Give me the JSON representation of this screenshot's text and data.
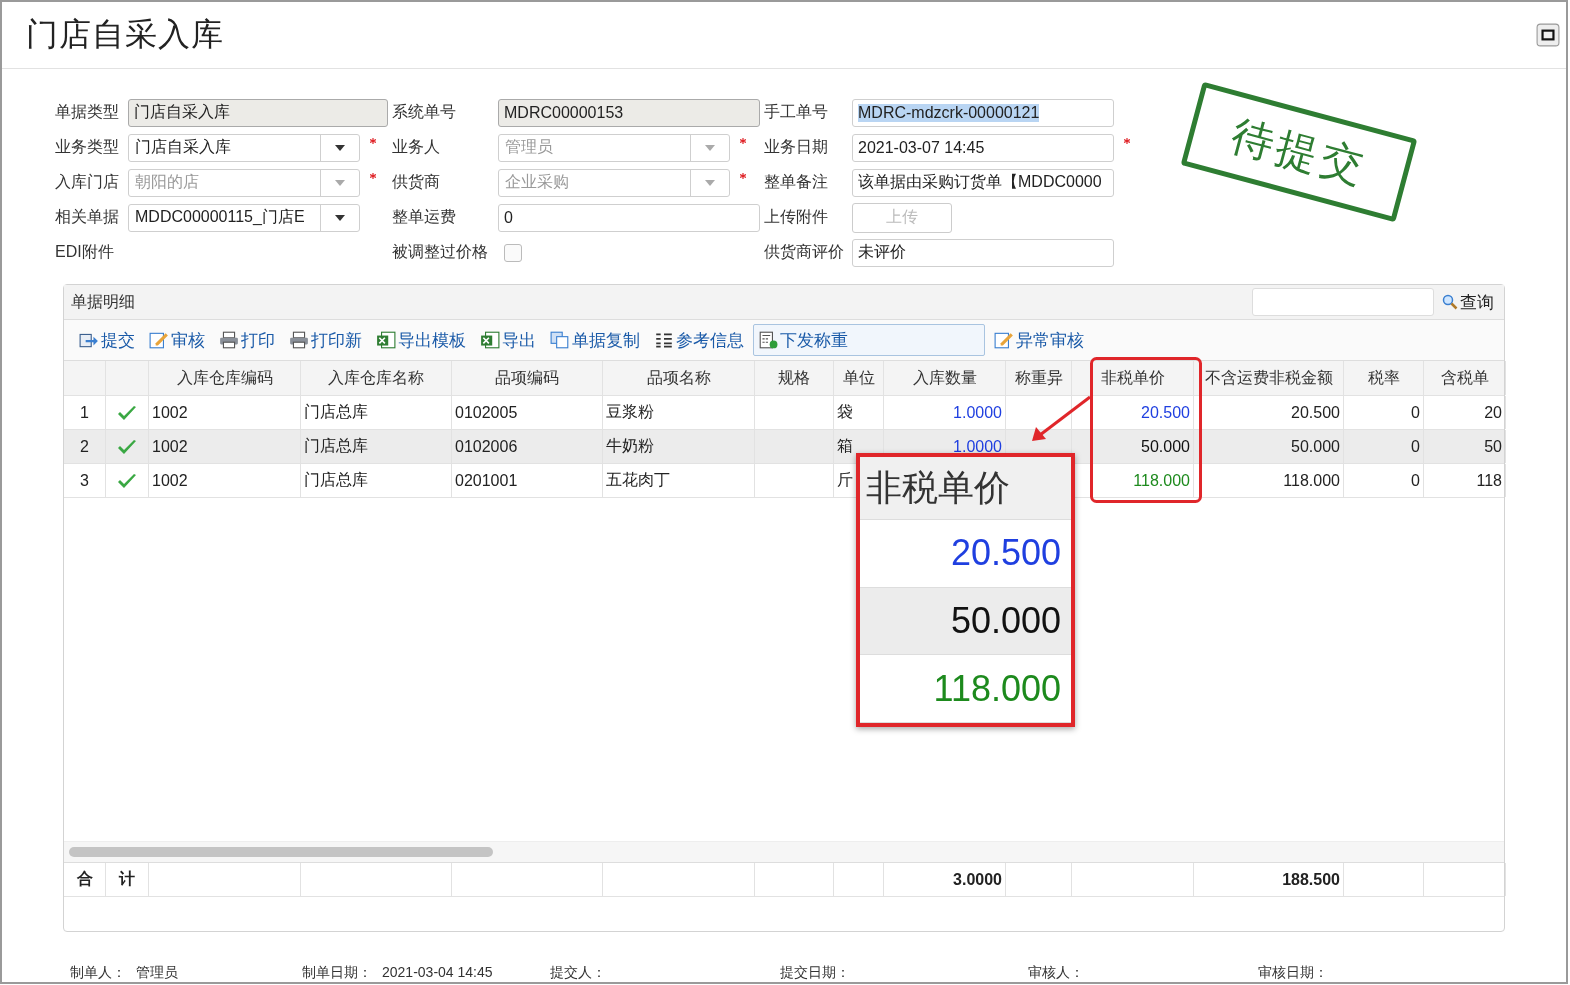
{
  "window": {
    "title": "门店自采入库"
  },
  "form": {
    "rows": [
      [
        {
          "label": "单据类型",
          "value": "门店自采入库",
          "kind": "readonly"
        },
        {
          "label": "系统单号",
          "value": "MDRC00000153",
          "kind": "readonly"
        },
        {
          "label": "手工单号",
          "value": "MDRC-mdzcrk-00000121",
          "kind": "text",
          "highlighted": true
        }
      ],
      [
        {
          "label": "业务类型",
          "value": "门店自采入库",
          "kind": "select",
          "required": true,
          "disabled": false
        },
        {
          "label": "业务人",
          "value": "管理员",
          "kind": "select",
          "required": true,
          "disabled": true
        },
        {
          "label": "业务日期",
          "value": "2021-03-07 14:45",
          "kind": "text",
          "required": true
        }
      ],
      [
        {
          "label": "入库门店",
          "value": "朝阳的店",
          "kind": "select",
          "required": true,
          "disabled": true
        },
        {
          "label": "供货商",
          "value": "企业采购",
          "kind": "select",
          "required": true,
          "disabled": true
        },
        {
          "label": "整单备注",
          "value": "该单据由采购订货单【MDDC0000",
          "kind": "text"
        }
      ],
      [
        {
          "label": "相关单据",
          "value": "MDDC00000115_门店E",
          "kind": "select",
          "disabled": false
        },
        {
          "label": "整单运费",
          "value": "0",
          "kind": "text"
        },
        {
          "label": "上传附件",
          "value": "上传",
          "kind": "button",
          "disabled": true
        }
      ],
      [
        {
          "label": "EDI附件",
          "kind": "none"
        },
        {
          "label": "被调整过价格",
          "kind": "checkbox",
          "checked": false
        },
        {
          "label": "供货商评价",
          "value": "未评价",
          "kind": "text"
        }
      ]
    ]
  },
  "stamp": {
    "text": "待提交"
  },
  "detail": {
    "title": "单据明细",
    "search": {
      "button": "查询"
    },
    "toolbar": [
      {
        "label": "提交",
        "kind": "submit",
        "selected": false
      },
      {
        "label": "审核",
        "kind": "edit",
        "selected": false
      },
      {
        "label": "打印",
        "kind": "print",
        "selected": false
      },
      {
        "label": "打印新",
        "kind": "print",
        "selected": false
      },
      {
        "label": "导出模板",
        "kind": "excel",
        "selected": false
      },
      {
        "label": "导出",
        "kind": "excel",
        "selected": false
      },
      {
        "label": "单据复制",
        "kind": "copy",
        "selected": false
      },
      {
        "label": "参考信息",
        "kind": "list",
        "selected": false
      },
      {
        "label": "下发称重",
        "kind": "calc",
        "selected": true
      },
      {
        "label": "异常审核",
        "kind": "edit",
        "selected": false
      }
    ],
    "table": {
      "columns": [
        "入库仓库编码",
        "入库仓库名称",
        "品项编码",
        "品项名称",
        "规格",
        "单位",
        "入库数量",
        "称重异",
        "非税单价",
        "不含运费非税金额",
        "税率",
        "含税单"
      ],
      "rows": [
        {
          "index": "1",
          "selected": false,
          "checked": true,
          "cells": [
            "1002",
            "门店总库",
            "0102005",
            "豆浆粉",
            "",
            "袋",
            "1.0000",
            "",
            "20.500",
            "20.500",
            "0",
            "20"
          ],
          "color": "#1f3fe0"
        },
        {
          "index": "2",
          "selected": true,
          "checked": true,
          "cells": [
            "1002",
            "门店总库",
            "0102006",
            "牛奶粉",
            "",
            "箱",
            "1.0000",
            "",
            "50.000",
            "50.000",
            "0",
            "50"
          ],
          "color": "#111111"
        },
        {
          "index": "3",
          "selected": false,
          "checked": true,
          "cells": [
            "1002",
            "门店总库",
            "0201001",
            "五花肉丁",
            "",
            "斤",
            "",
            "",
            "118.000",
            "118.000",
            "0",
            "118"
          ],
          "color": "#1d8a1d"
        }
      ],
      "totals": {
        "label_1": "合",
        "label_2": "计",
        "quantity": "3.0000",
        "amount": "188.500"
      }
    }
  },
  "callout": {
    "title": "非税单价",
    "items": [
      {
        "text": "20.500",
        "color": "#1f3fe0"
      },
      {
        "text": "50.000",
        "color": "#111111"
      },
      {
        "text": "118.000",
        "color": "#1d8a1d"
      }
    ]
  },
  "footer": [
    {
      "label": "制单人：",
      "value": "管理员"
    },
    {
      "label": "制单日期：",
      "value": "2021-03-04 14:45"
    },
    {
      "label": "提交人："
    },
    {
      "label": "提交日期："
    },
    {
      "label": "审核人："
    },
    {
      "label": "审核日期："
    }
  ]
}
